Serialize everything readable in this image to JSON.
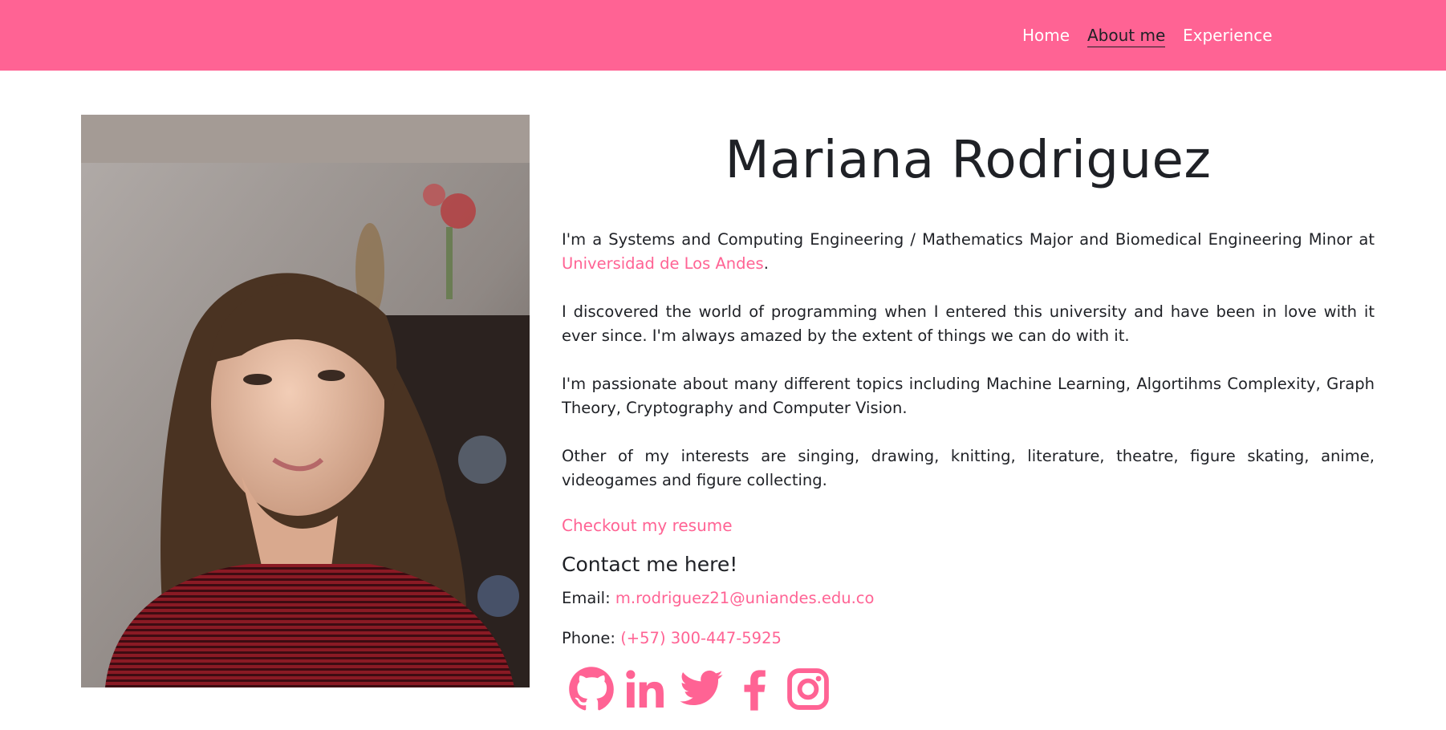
{
  "nav": {
    "home": "Home",
    "about": "About me",
    "experience": "Experience"
  },
  "profile": {
    "name": "Mariana Rodriguez",
    "p1_text": "I'm a Systems and Computing Engineering / Mathematics Major and Biomedical Engineering Minor at ",
    "p1_link": "Universidad de Los Andes",
    "p1_end": ".",
    "p2": "I discovered the world of programming when I entered this university and have been in love with it ever since. I'm always amazed by the extent of things we can do with it.",
    "p3": "I'm passionate about many different topics including Machine Learning, Algortihms Complexity, Graph Theory, Cryptography and Computer Vision.",
    "p4": "Other of my interests are singing, drawing, knitting, literature, theatre, figure skating, anime, videogames and figure collecting.",
    "resume_link": "Checkout my resume"
  },
  "contact": {
    "heading": "Contact me here!",
    "email_label": "Email: ",
    "email": "m.rodriguez21@uniandes.edu.co",
    "phone_label": "Phone: ",
    "phone": "(+57) 300-447-5925"
  },
  "socials": [
    "github-icon",
    "linkedin-icon",
    "twitter-icon",
    "facebook-icon",
    "instagram-icon"
  ],
  "colors": {
    "accent": "#ff6394",
    "text": "#1f2126"
  }
}
